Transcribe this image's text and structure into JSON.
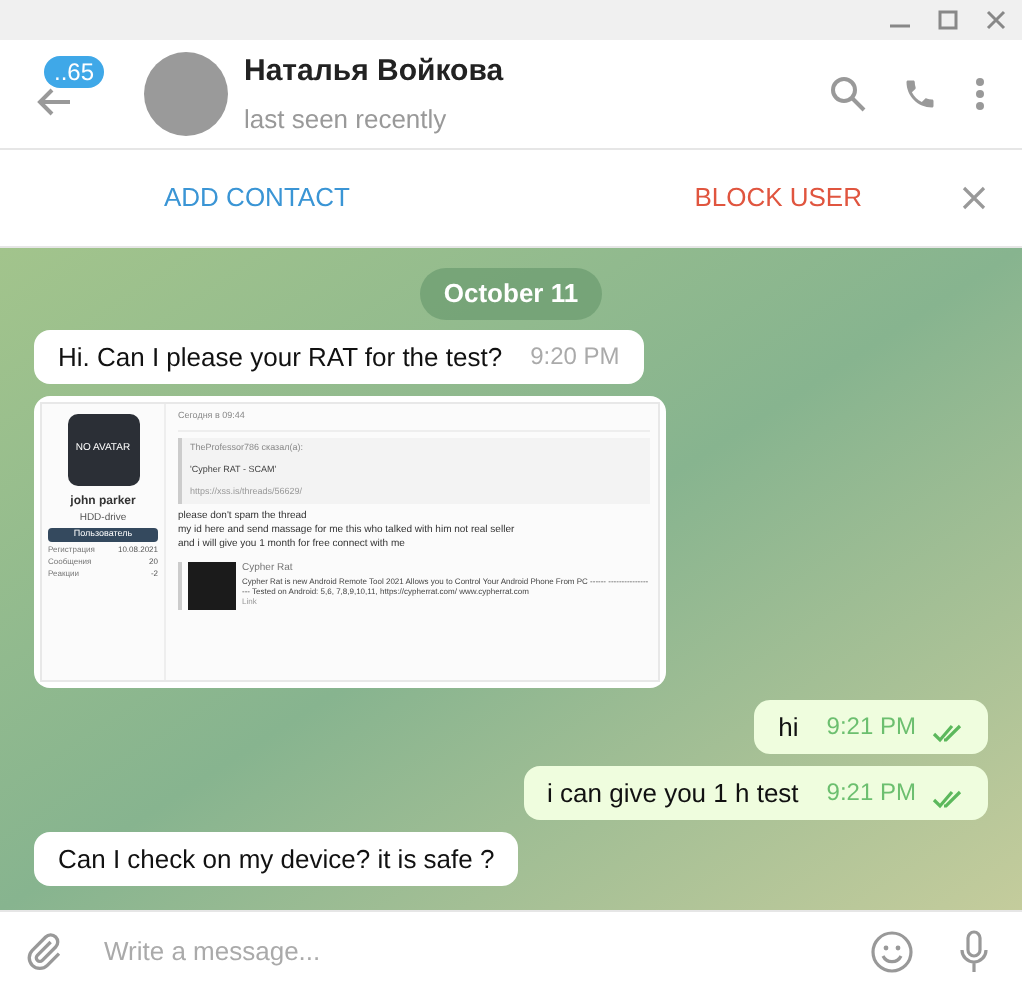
{
  "header": {
    "unread_badge": "..65",
    "title": "Наталья Войкова",
    "status": "last seen recently"
  },
  "action_bar": {
    "add_contact": "ADD CONTACT",
    "block_user": "BLOCK USER"
  },
  "date_chip": "October 11",
  "messages": [
    {
      "kind": "text",
      "outgoing": false,
      "text": "Hi. Can I please your RAT for the test?",
      "time": "9:20 PM"
    },
    {
      "kind": "screenshot",
      "outgoing": false,
      "post": {
        "avatar": "NO AVATAR",
        "user": "john parker",
        "user_title": "HDD-drive",
        "role": "Пользователь",
        "stats": [
          {
            "label": "Регистрация",
            "value": "10.08.2021"
          },
          {
            "label": "Сообщения",
            "value": "20"
          },
          {
            "label": "Реакции",
            "value": "-2"
          }
        ],
        "date": "Сегодня в 09:44",
        "quote_author": "TheProfessor786 сказал(а):",
        "quote_text": "'Cypher RAT - SCAM'",
        "quote_link": "https://xss.is/threads/56629/",
        "body": [
          "please don't spam the thread",
          "my id here and send massage for me this who talked with him not real seller",
          "and i will give you 1 month for free connect with me"
        ],
        "embed_title": "Cypher Rat",
        "embed_text": "Cypher Rat is new Android Remote Tool 2021 Allows you to Control Your Android Phone From PC ------ ------------------ Tested on Android: 5,6, 7,8,9,10,11, https://cypherrat.com/ www.cypherrat.com",
        "embed_link": "Link"
      }
    },
    {
      "kind": "text",
      "outgoing": true,
      "text": "hi",
      "time": "9:21 PM",
      "read": true
    },
    {
      "kind": "text",
      "outgoing": true,
      "text": "i can give you 1 h test",
      "time": "9:21 PM",
      "read": true
    },
    {
      "kind": "text",
      "outgoing": false,
      "text": "Can I check on my device? it is safe ?"
    }
  ],
  "composer": {
    "placeholder": "Write a message..."
  }
}
